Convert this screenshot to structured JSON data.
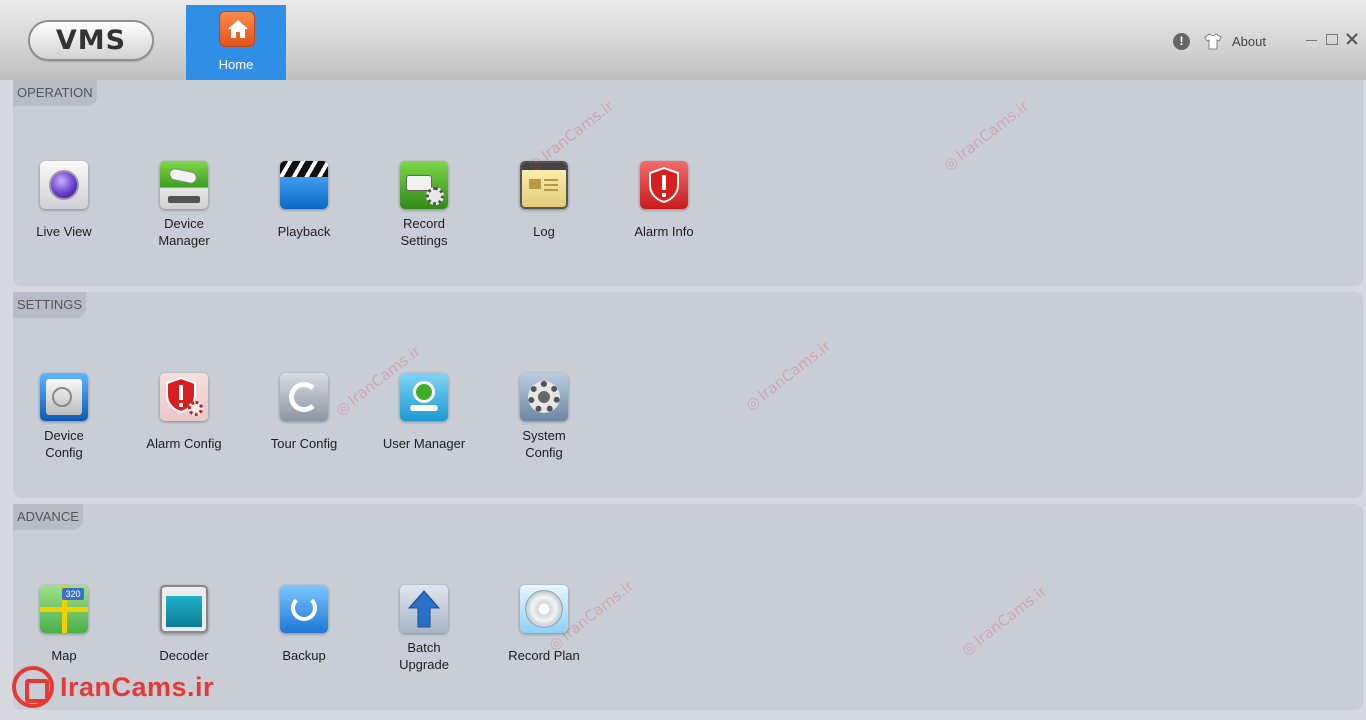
{
  "app": {
    "logo_text": "VMS",
    "home_tab": "Home",
    "about": "About",
    "info_glyph": "!"
  },
  "sections": [
    {
      "label": "OPERATION",
      "items": [
        {
          "label": "Live View",
          "icon": "live-view-icon"
        },
        {
          "label": "Device\nManager",
          "icon": "device-manager-icon"
        },
        {
          "label": "Playback",
          "icon": "playback-icon"
        },
        {
          "label": "Record\nSettings",
          "icon": "record-settings-icon"
        },
        {
          "label": "Log",
          "icon": "log-icon"
        },
        {
          "label": "Alarm Info",
          "icon": "alarm-info-icon"
        }
      ]
    },
    {
      "label": "SETTINGS",
      "items": [
        {
          "label": "Device\nConfig",
          "icon": "device-config-icon"
        },
        {
          "label": "Alarm Config",
          "icon": "alarm-config-icon"
        },
        {
          "label": "Tour Config",
          "icon": "tour-config-icon"
        },
        {
          "label": "User Manager",
          "icon": "user-manager-icon"
        },
        {
          "label": "System\nConfig",
          "icon": "system-config-icon"
        }
      ]
    },
    {
      "label": "ADVANCE",
      "items": [
        {
          "label": "Map",
          "icon": "map-icon"
        },
        {
          "label": "Decoder",
          "icon": "decoder-icon"
        },
        {
          "label": "Backup",
          "icon": "backup-icon"
        },
        {
          "label": "Batch\nUpgrade",
          "icon": "batch-upgrade-icon"
        },
        {
          "label": "Record Plan",
          "icon": "record-plan-icon"
        }
      ]
    }
  ],
  "map_icon_badge": "320",
  "watermark": {
    "text": "IranCams.ir",
    "brand": "IranCams.ir"
  },
  "colors": {
    "accent": "#2f8fe6",
    "brand": "#e53935"
  }
}
